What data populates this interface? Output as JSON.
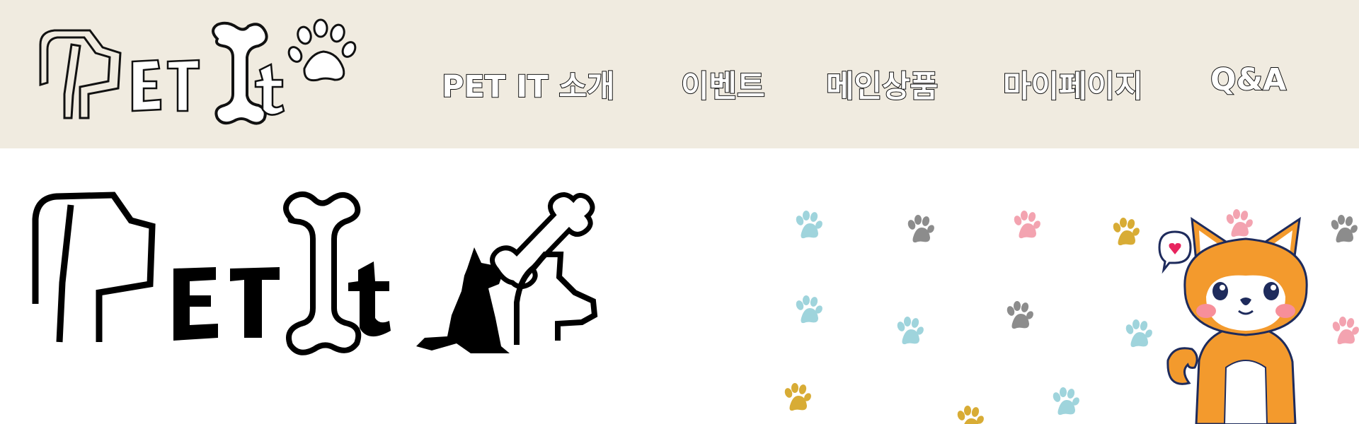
{
  "header": {
    "logo_text": "PET It",
    "background": "#f0ebe0",
    "nav": [
      {
        "label": "PET IT 소개"
      },
      {
        "label": "이벤트"
      },
      {
        "label": "메인상품"
      },
      {
        "label": "마이페이지"
      },
      {
        "label": "Q&A"
      }
    ]
  },
  "hero": {
    "logo_text": "PET It",
    "icons": [
      "dog-silhouette-icon",
      "bone-icon",
      "cat-outline-icon",
      "paw-print-icon",
      "shiba-dog-illustration"
    ],
    "paw_colors": [
      "#9fd4dc",
      "#8c8c8c",
      "#f3a3b0",
      "#d8ac35"
    ]
  }
}
